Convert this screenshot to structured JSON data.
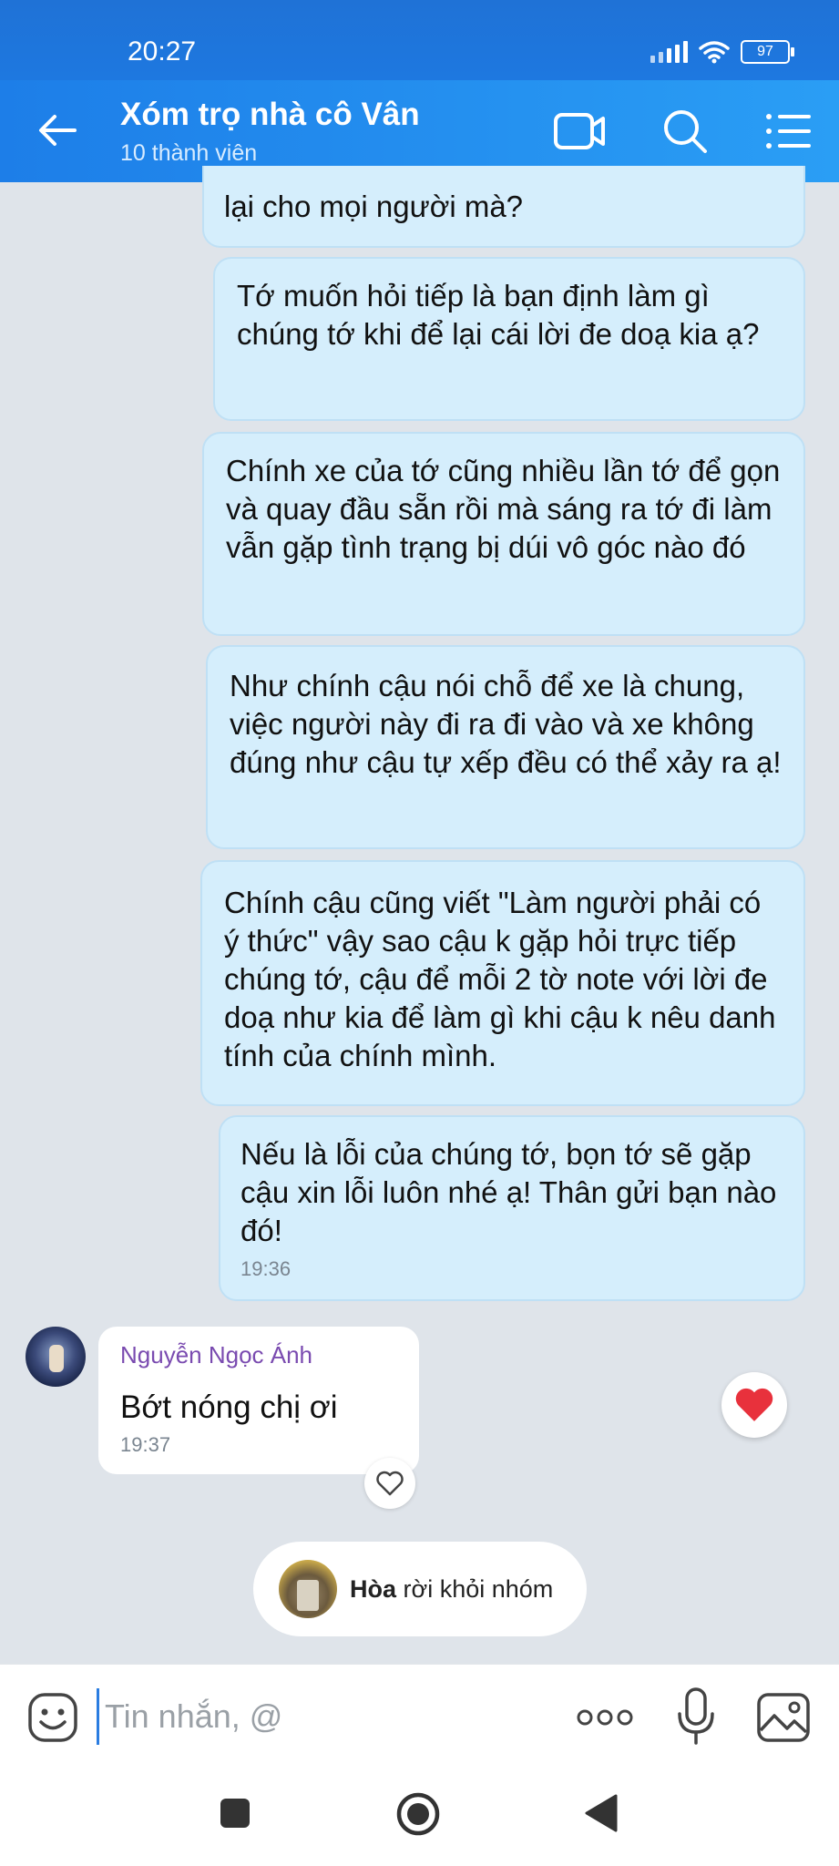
{
  "status_bar": {
    "time": "20:27",
    "battery": "97"
  },
  "header": {
    "title": "Xóm trọ nhà cô Vân",
    "subtitle": "10 thành viên"
  },
  "messages_out": [
    {
      "text": "lại cho mọi người mà?"
    },
    {
      "text": "Tớ muốn hỏi tiếp là bạn định làm gì chúng tớ khi để lại cái lời đe doạ kia ạ?"
    },
    {
      "text": "Chính xe của tớ cũng nhiều lần tớ để gọn và quay đầu sẵn rồi mà sáng ra tớ đi làm vẫn gặp tình trạng bị dúi vô góc nào đó"
    },
    {
      "text": "Như chính cậu nói chỗ để xe là chung, việc người này đi ra đi vào và xe không đúng như cậu tự xếp đều có thể xảy ra ạ!"
    },
    {
      "text": "Chính cậu cũng viết \"Làm người phải có ý thức\" vậy sao cậu k gặp hỏi trực tiếp chúng tớ, cậu để mỗi 2 tờ note với lời đe doạ như kia để làm gì khi cậu k nêu danh tính của chính mình."
    },
    {
      "text": "Nếu là lỗi của chúng tớ, bọn tớ sẽ gặp cậu xin lỗi luôn nhé ạ! Thân gửi bạn nào đó!",
      "time": "19:36"
    }
  ],
  "message_in": {
    "sender": "Nguyễn Ngọc Ánh",
    "text": "Bớt nóng chị ơi",
    "time": "19:37",
    "reaction": "heart"
  },
  "system_message": {
    "name": "Hòa",
    "action": "rời khỏi nhóm"
  },
  "input": {
    "placeholder": "Tin nhắn, @"
  },
  "colors": {
    "header": "#1e7ee8",
    "bubble_out": "#d5eefc",
    "sender_name": "#7a4bb0"
  }
}
